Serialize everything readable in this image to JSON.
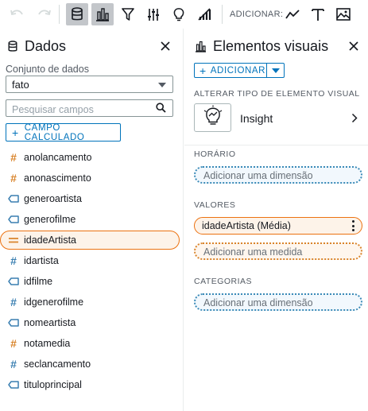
{
  "toolbar": {
    "adicionar_label": "ADICIONAR:"
  },
  "left_panel": {
    "title": "Dados",
    "dataset_label": "Conjunto de dados",
    "dataset_value": "fato",
    "search_placeholder": "Pesquisar campos",
    "calc_field_label": "CAMPO CALCULADO",
    "fields": [
      {
        "name": "anolancamento",
        "type": "measure-hash-orange"
      },
      {
        "name": "anonascimento",
        "type": "measure-hash-orange"
      },
      {
        "name": "generoartista",
        "type": "dimension-tag"
      },
      {
        "name": "generofilme",
        "type": "dimension-tag"
      },
      {
        "name": "idadeArtista",
        "type": "calculated-equals",
        "selected": true
      },
      {
        "name": "idartista",
        "type": "dimension-hash-blue"
      },
      {
        "name": "idfilme",
        "type": "dimension-tag"
      },
      {
        "name": "idgenerofilme",
        "type": "dimension-hash-blue"
      },
      {
        "name": "nomeartista",
        "type": "dimension-tag"
      },
      {
        "name": "notamedia",
        "type": "measure-hash-orange"
      },
      {
        "name": "seclancamento",
        "type": "dimension-hash-blue"
      },
      {
        "name": "tituloprincipal",
        "type": "dimension-tag"
      }
    ]
  },
  "right_panel": {
    "title": "Elementos visuais",
    "add_label": "ADICIONAR",
    "change_visual_label": "ALTERAR TIPO DE ELEMENTO VISUAL",
    "visual_type": "Insight",
    "sections": {
      "time": {
        "label": "HORÁRIO",
        "placeholder": "Adicionar uma dimensão"
      },
      "values": {
        "label": "VALORES",
        "field": "idadeArtista (Média)",
        "placeholder": "Adicionar uma medida"
      },
      "categories": {
        "label": "CATEGORIAS",
        "placeholder": "Adicionar uma dimensão"
      }
    }
  },
  "colors": {
    "accent": "#0073bb",
    "measure": "#ec7211",
    "dimension": "#3a8ab7"
  }
}
